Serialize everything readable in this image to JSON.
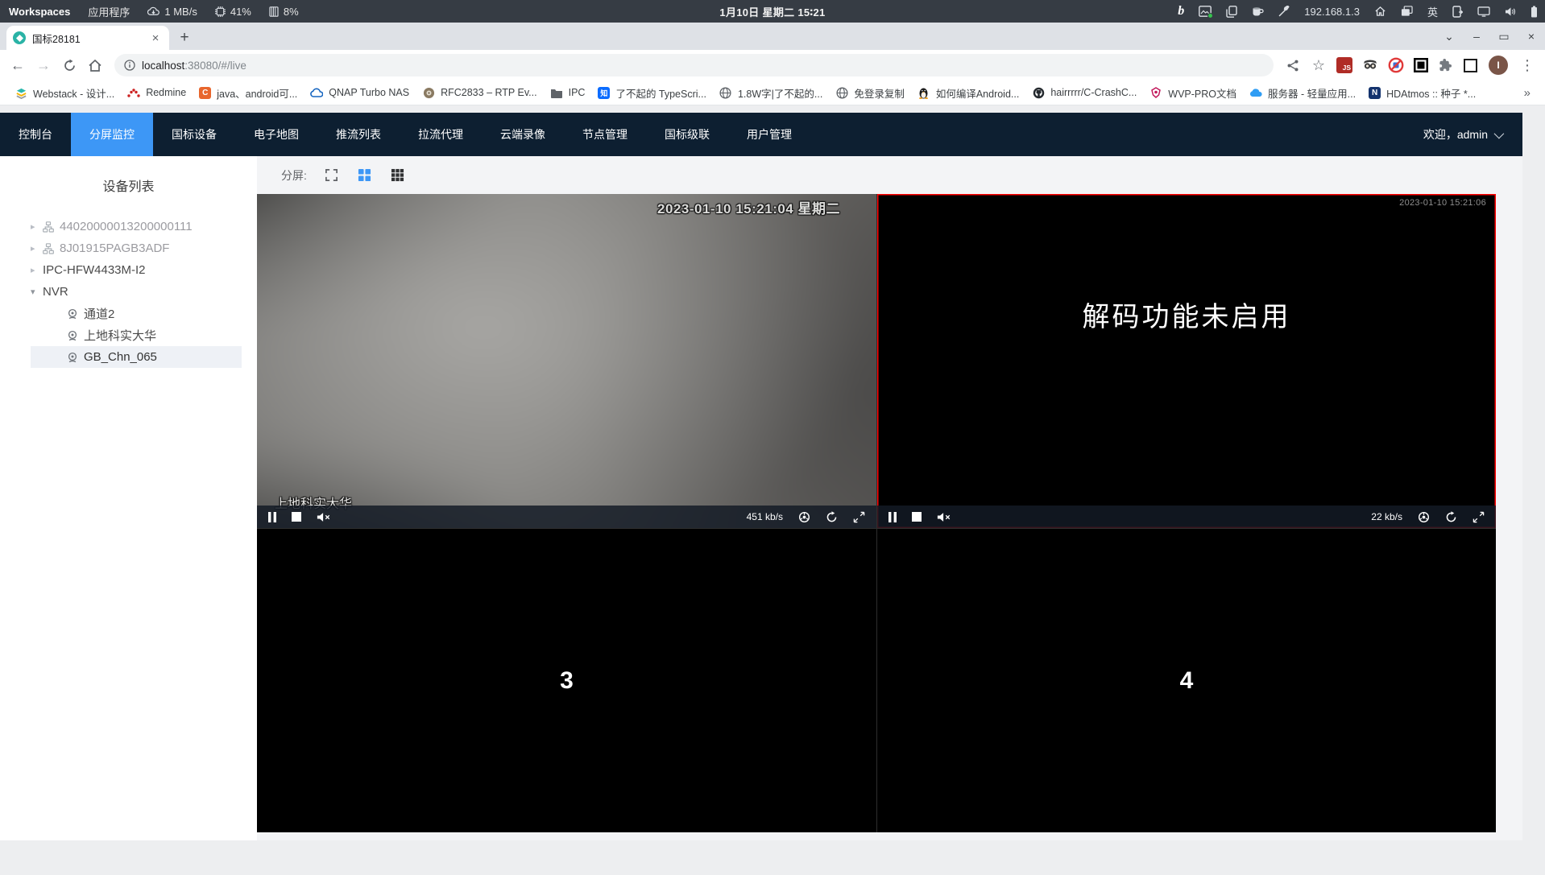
{
  "system_bar": {
    "workspaces_label": "Workspaces",
    "apps_label": "应用程序",
    "net_speed": "1 MB/s",
    "cpu_usage": "41%",
    "mem_usage": "8%",
    "clock": "1月10日 星期二 15∶21",
    "ip_address": "192.168.1.3",
    "input_method": "英"
  },
  "browser": {
    "tab_title": "国标28181",
    "url_host": "localhost",
    "url_rest": ":38080/#/live",
    "profile_initial": "I",
    "bookmarks": [
      {
        "label": "Webstack - 设计...",
        "icon": "webstack-icon"
      },
      {
        "label": "Redmine",
        "icon": "redmine-icon"
      },
      {
        "label": "java、android可...",
        "icon": "csdn-c-icon"
      },
      {
        "label": "QNAP Turbo NAS",
        "icon": "qnap-cloud-icon"
      },
      {
        "label": "RFC2833 – RTP Ev...",
        "icon": "disc-icon"
      },
      {
        "label": "IPC",
        "icon": "folder-icon"
      },
      {
        "label": "了不起的 TypeScri...",
        "icon": "zhihu-icon"
      },
      {
        "label": "1.8W字|了不起的...",
        "icon": "globe-icon"
      },
      {
        "label": "免登录复制",
        "icon": "globe-icon"
      },
      {
        "label": "如何编译Android...",
        "icon": "penguin-icon"
      },
      {
        "label": "hairrrrr/C-CrashC...",
        "icon": "github-icon"
      },
      {
        "label": "WVP-PRO文档",
        "icon": "wvp-logo-icon"
      },
      {
        "label": "服务器 - 轻量应用...",
        "icon": "tencent-cloud-icon"
      },
      {
        "label": "HDAtmos :: 种子 *...",
        "icon": "n-badge-icon"
      }
    ],
    "bookmarks_overflow": "»"
  },
  "app": {
    "nav_items": [
      "控制台",
      "分屏监控",
      "国标设备",
      "电子地图",
      "推流列表",
      "拉流代理",
      "云端录像",
      "节点管理",
      "国标级联",
      "用户管理"
    ],
    "active_nav": "分屏监控",
    "welcome_text": "欢迎，admin",
    "sidebar_title": "设备列表",
    "device_tree": [
      "44020000013200000111",
      "8J01915PAGB3ADF",
      "IPC-HFW4433M-I2",
      "NVR",
      "通道2",
      "上地科实大华",
      "GB_Chn_065"
    ],
    "selected_device": "GB_Chn_065",
    "split_label": "分屏:",
    "players": {
      "p1": {
        "timestamp": "2023-01-10 15:21:04 星期二",
        "name": "上地科实大华",
        "bitrate": "451 kb/s"
      },
      "p2": {
        "timestamp": "2023-01-10 15:21:06",
        "message": "解码功能未启用",
        "bitrate": "22 kb/s"
      },
      "p3": {
        "number": "3"
      },
      "p4": {
        "number": "4"
      }
    },
    "colors": {
      "accent_blue": "#3d97f6",
      "nav_bg": "#0d1f31",
      "selected_border": "#ff0000"
    }
  },
  "glyphs": {
    "close": "×",
    "plus": "+",
    "back": "←",
    "forward": "→",
    "menu_dots": "⋮",
    "star": "☆",
    "caret_down": "⌄",
    "minimize": "–",
    "maximize": "▭",
    "expand_right": "▸",
    "expand_down": "▾",
    "js_badge": "JS",
    "bing_b": "b",
    "zhihu": "知",
    "c_badge": "C",
    "n_badge": "N"
  }
}
